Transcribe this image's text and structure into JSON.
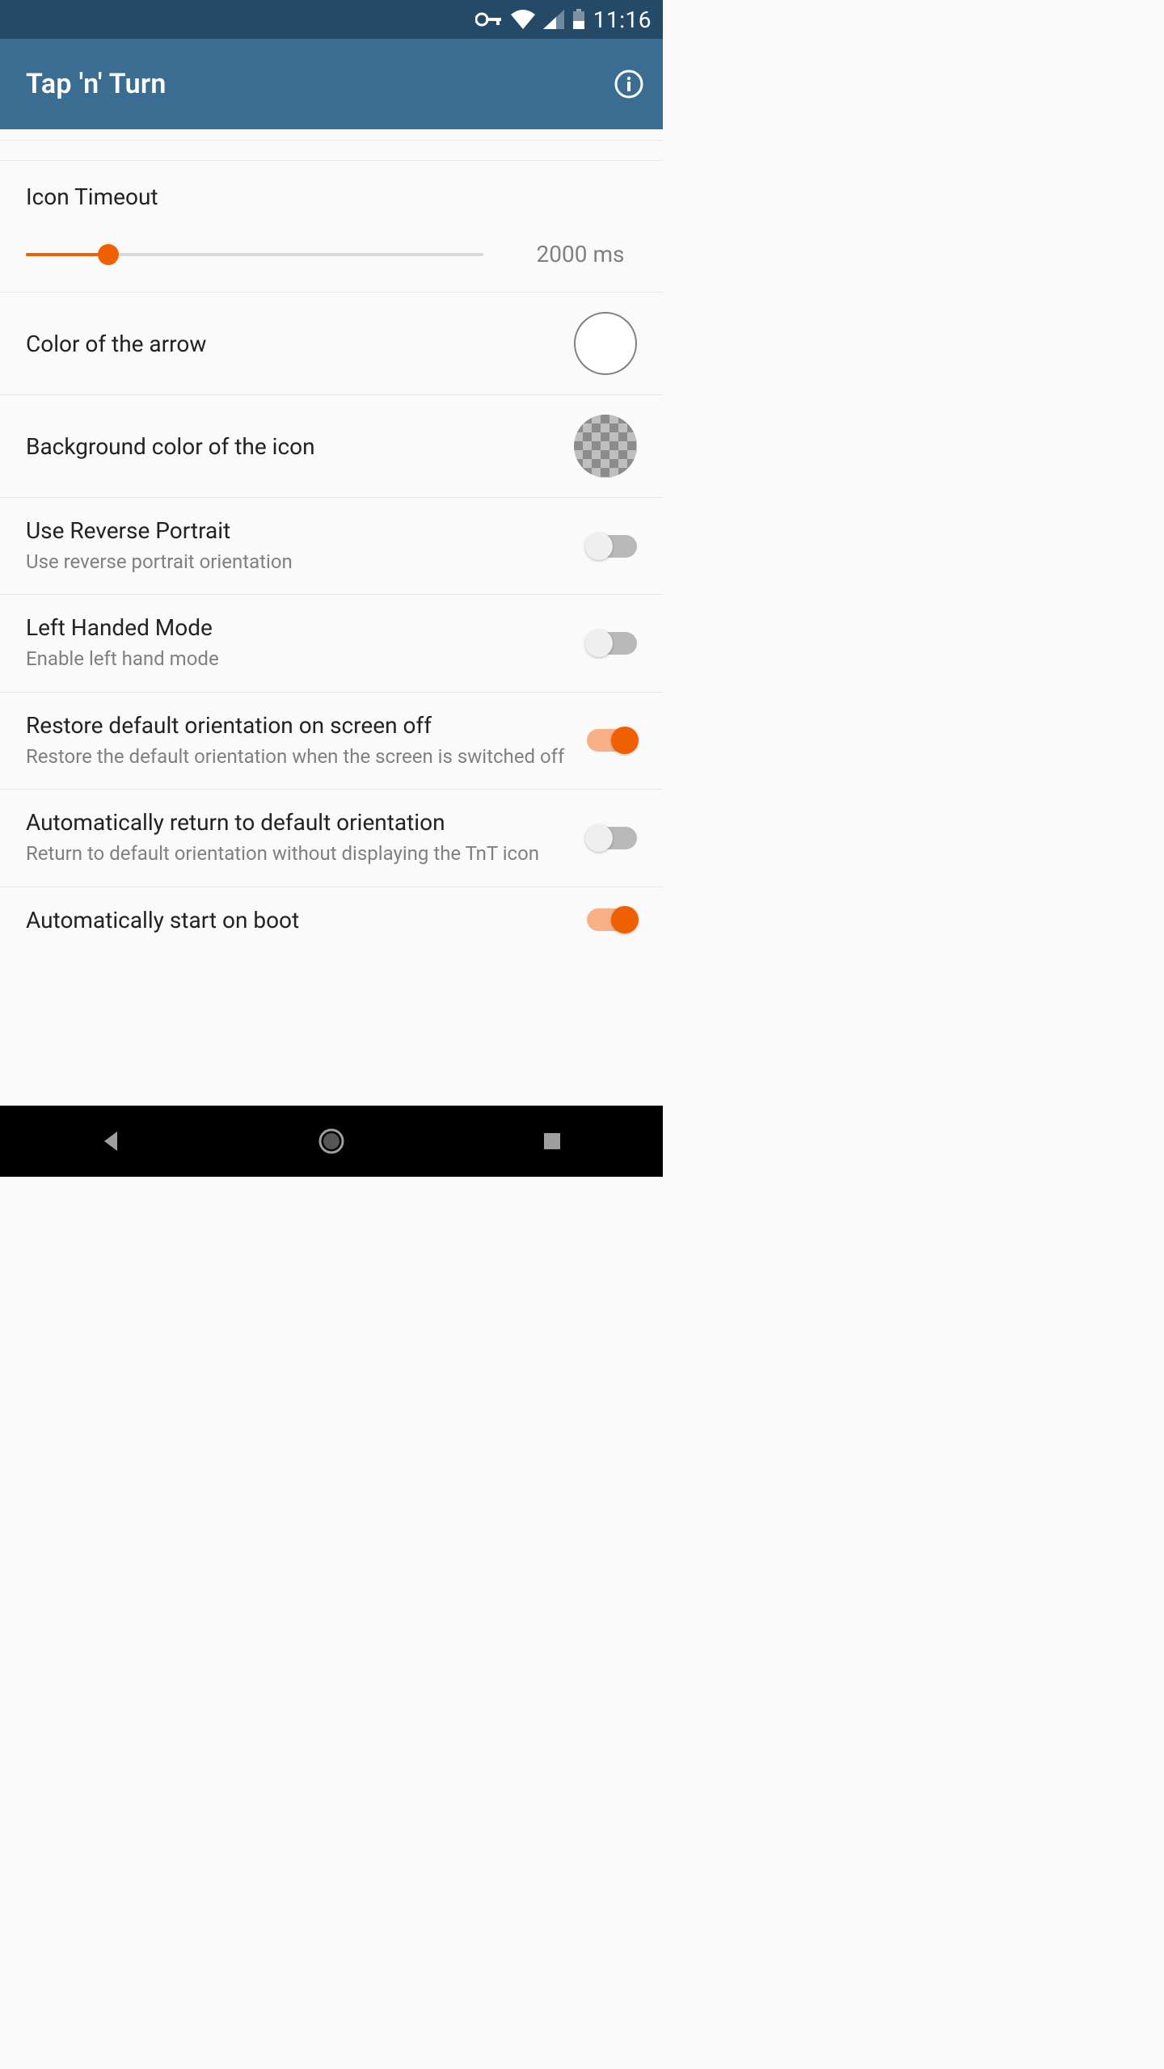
{
  "status": {
    "time": "11:16"
  },
  "appbar": {
    "title": "Tap 'n' Turn"
  },
  "settings": {
    "iconTimeout": {
      "title": "Icon Timeout",
      "value": "2000 ms",
      "percent": 18
    },
    "arrowColor": {
      "title": "Color of the arrow"
    },
    "bgColor": {
      "title": "Background color of the icon"
    },
    "reversePortrait": {
      "title": "Use Reverse Portrait",
      "sub": "Use reverse portrait orientation",
      "on": false
    },
    "leftHanded": {
      "title": "Left Handed Mode",
      "sub": "Enable left hand mode",
      "on": false
    },
    "restoreDefault": {
      "title": "Restore default orientation on screen off",
      "sub": "Restore the default orientation when the screen is switched off",
      "on": true
    },
    "autoReturn": {
      "title": "Automatically return to default orientation",
      "sub": "Return to default orientation without displaying the TnT icon",
      "on": false
    },
    "startOnBoot": {
      "title": "Automatically start on boot",
      "on": true
    }
  }
}
